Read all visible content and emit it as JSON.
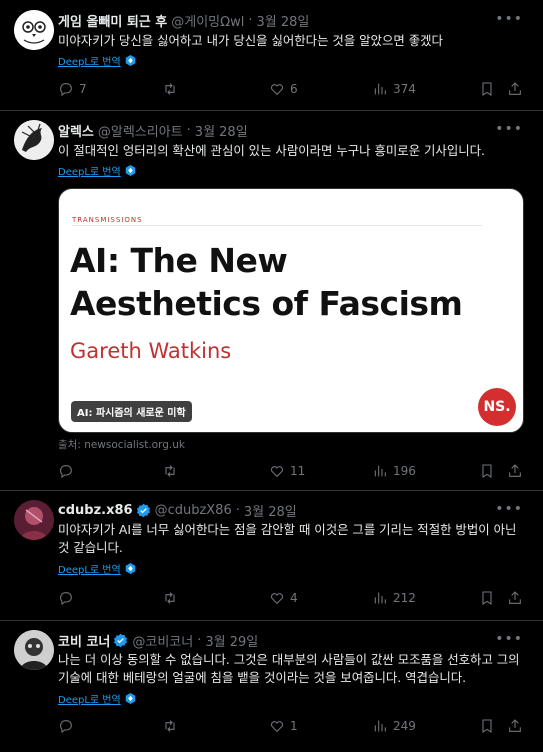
{
  "icons": {
    "verified": "verified-badge-icon",
    "translate": "translate-badge-icon"
  },
  "colors": {
    "accent": "#1d9bf0",
    "muted": "#71767b",
    "card_red": "#c23030"
  },
  "tweets": [
    {
      "name": "게임 올빼미 퇴근 후",
      "handle": "@게이밍Ωwl",
      "date": "3월 28일",
      "text": "미야자키가 당신을 싫어하고 내가 당신을 싫어한다는 것을 알았으면 좋겠다",
      "translate": "DeepL로 번역",
      "replies": "7",
      "retweets": "",
      "likes": "6",
      "views": "374"
    },
    {
      "name": "알렉스",
      "handle": "@알렉스리아트",
      "date": "3월 28일",
      "text": "이 절대적인 엉터리의 확산에 관심이 있는 사람이라면 누구나 흥미로운 기사입니다.",
      "translate": "DeepL로 번역",
      "card": {
        "kicker": "TRANSMISSIONS",
        "title1": "AI: The New",
        "title2": "Aesthetics of Fascism",
        "author": "Gareth Watkins",
        "badge": "AI: 파시즘의 새로운 미학",
        "logo": "NS.",
        "source": "출처: newsocialist.org.uk"
      },
      "replies": "",
      "retweets": "",
      "likes": "11",
      "views": "196"
    },
    {
      "name": "cdubz.x86",
      "handle": "@cdubzX86",
      "date": "3월 28일",
      "text": "미야자키가 AI를 너무 싫어한다는 점을 감안할 때 이것은 그를 기리는 적절한 방법이 아닌 것 같습니다.",
      "translate": "DeepL로 번역",
      "replies": "",
      "retweets": "",
      "likes": "4",
      "views": "212"
    },
    {
      "name": "코비 코너",
      "handle": "@코비코너",
      "date": "3월 29일",
      "text": "나는 더 이상 동의할 수 없습니다. 그것은 대부분의 사람들이 값싼 모조품을 선호하고 그의 기술에 대한 베테랑의 얼굴에 침을 뱉을 것이라는 것을 보여줍니다. 역겹습니다.",
      "translate": "DeepL로 번역",
      "replies": "",
      "retweets": "",
      "likes": "1",
      "views": "249"
    }
  ]
}
